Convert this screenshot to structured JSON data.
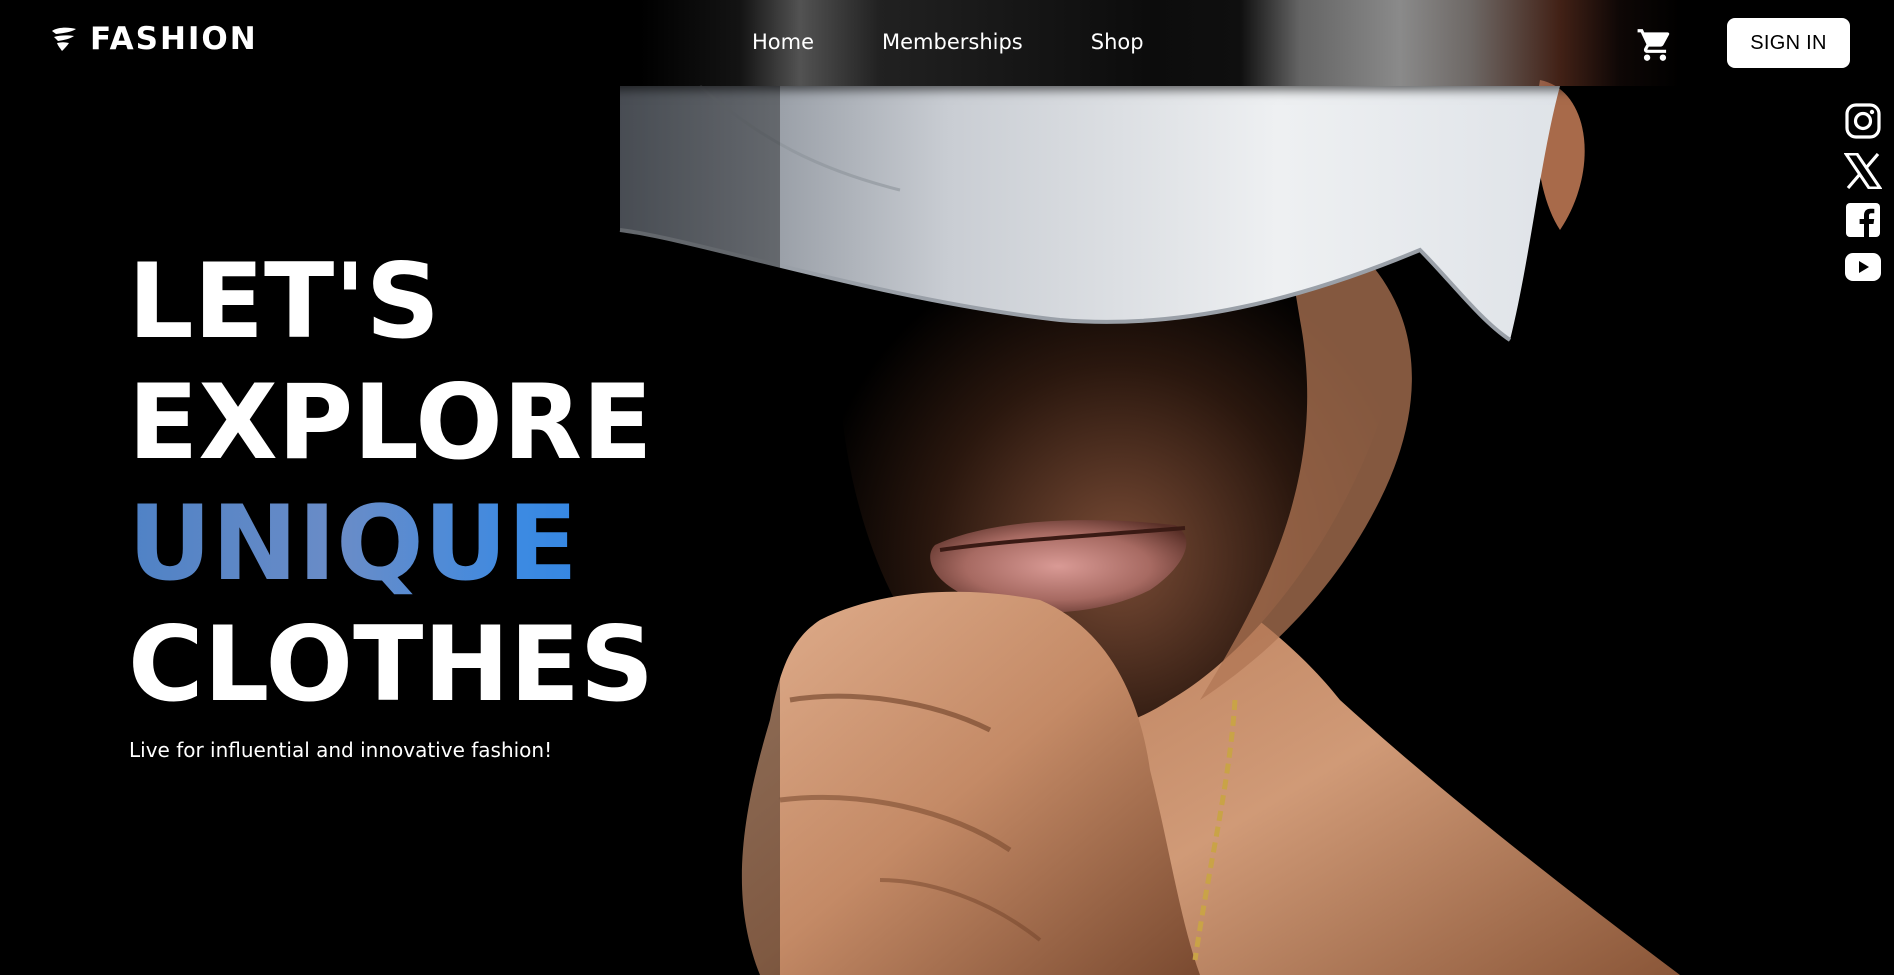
{
  "brand": {
    "name": "FASHION",
    "icon": "fire-swoosh-icon"
  },
  "nav": {
    "links": [
      {
        "label": "Home"
      },
      {
        "label": "Memberships"
      },
      {
        "label": "Shop"
      }
    ],
    "cart_icon": "shopping-cart-icon",
    "signin_label": "SIGN IN"
  },
  "social": [
    {
      "icon": "instagram-icon"
    },
    {
      "icon": "x-twitter-icon"
    },
    {
      "icon": "facebook-icon"
    },
    {
      "icon": "youtube-icon"
    }
  ],
  "hero": {
    "line1": "LET'S",
    "line2": "EXPLORE",
    "line3": "UNIQUE",
    "line4": "CLOTHES",
    "subtitle": "Live for influential and innovative fashion!"
  },
  "colors": {
    "background": "#000000",
    "accent_gradient_start": "#4f82c6",
    "accent_gradient_end": "#2d82e4",
    "button_bg": "#ffffff"
  }
}
